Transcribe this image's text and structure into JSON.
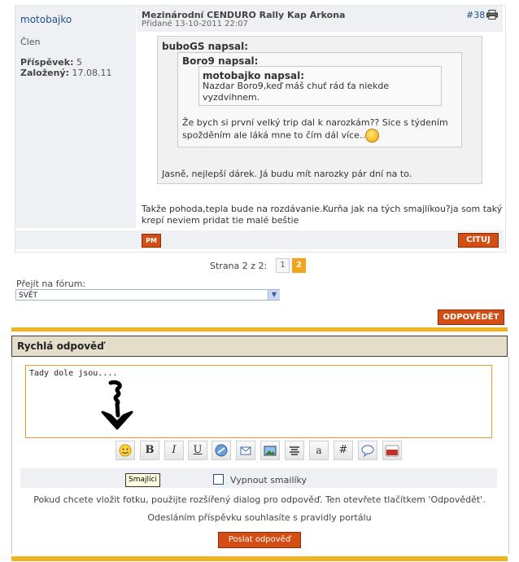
{
  "post": {
    "author": "motobajko",
    "rank": "Člen",
    "posts_label": "Příspěvek:",
    "posts_value": "5",
    "joined_label": "Založený:",
    "joined_value": "17.08.11",
    "title": "Mezinárodní CENDURO Rally Kap Arkona",
    "date": "Přidané 13-10-2011 22:07",
    "number": "#38",
    "quote_outer_author": "buboGS napsal:",
    "quote_mid_author": "Boro9 napsal:",
    "quote_inner_author": "motobajko napsal:",
    "quote_inner_text": "Nazdar Boro9,keď máš chuť rád ťa niekde vyzdvihnem.",
    "quote_mid_text": "Že bych si první velký trip dal k narozkám?? Sice s týdením spožděním ale láká mne to čím dál více..",
    "quote_outer_text": "Jasně, nejlepší dárek. Já budu mít narozky pár dní na to.",
    "body_text": "Takže pohoda,tepla bude na rozdávanie.Kurňa jak na tých smajlíkou?ja som taký krepí neviem pridat tie malé beštie",
    "pm_label": "PM",
    "cite_label": "CITUJ"
  },
  "pager": {
    "label": "Strana 2 z 2:",
    "pages": [
      "1",
      "2"
    ]
  },
  "forum_jump": {
    "label": "Přejít na fórum:",
    "selected": "SVĚT"
  },
  "reply_button": "ODPOVĚDĚT",
  "quick_reply": {
    "title": "Rychlá odpověď",
    "textarea_value": "Tady dole jsou....",
    "tooltip": "Smajlíci",
    "disable_smilies_label": "Vypnout smailíky",
    "info_line1": "Pokud chcete vložit fotku, použijte rozšířený dialog pro odpověď. Ten otevřete tlačítkem 'Odpovědět'.",
    "info_line2": "Odesláním příspěvku souhlasíte s pravidly portálu",
    "send_label": "Poslat odpověď",
    "toolbar": [
      "smiley-icon",
      "bold-icon",
      "italic-icon",
      "underline-icon",
      "link-icon",
      "email-icon",
      "image-icon",
      "align-center-icon",
      "font-icon",
      "hash-icon",
      "quote-icon",
      "youtube-icon"
    ],
    "toolbar_text": {
      "bold": "B",
      "italic": "I",
      "underline": "U",
      "font": "a",
      "hash": "#"
    }
  },
  "colors": {
    "accent": "#d24e14",
    "bar": "#f2b321",
    "link": "#1f4f8a"
  }
}
